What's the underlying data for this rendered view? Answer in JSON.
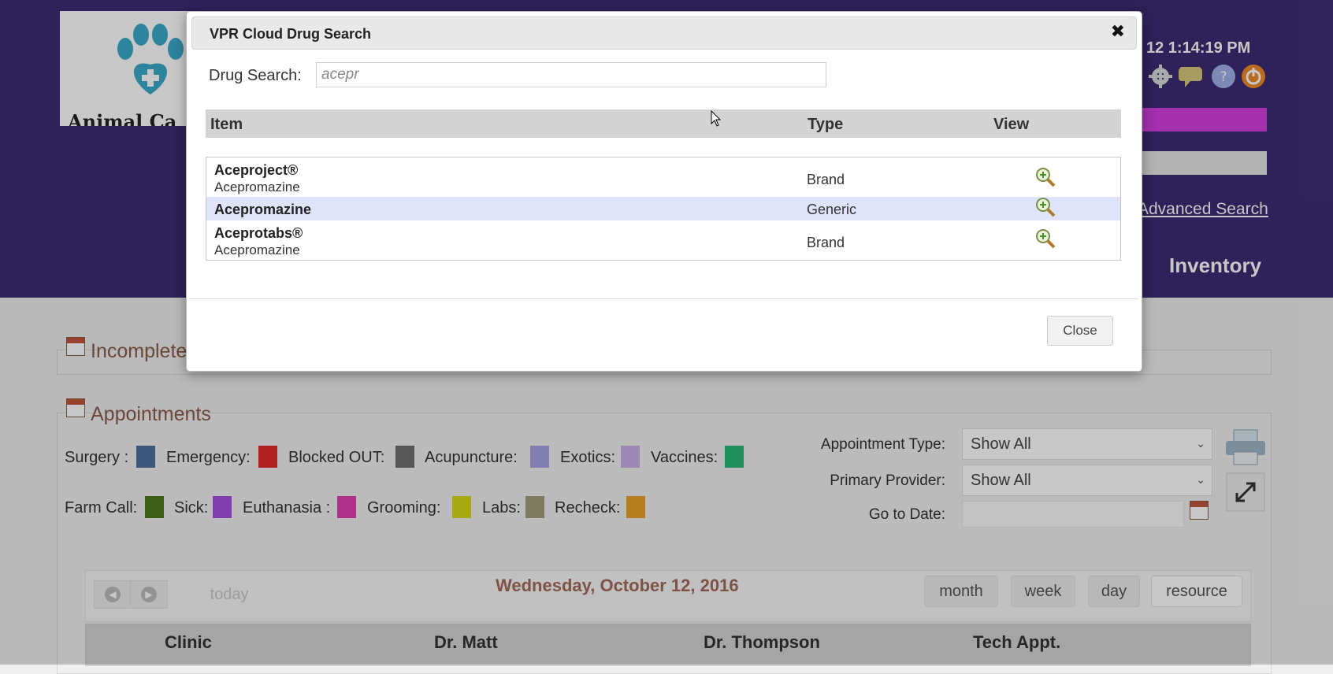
{
  "app": {
    "logo_text": "Animal Ca",
    "clock": "12 1:14:19 PM",
    "advanced_search": "Advanced Search",
    "inventory": "Inventory"
  },
  "incomplete": {
    "title": "Incomplete"
  },
  "appointments": {
    "title": "Appointments",
    "legend": [
      {
        "label": "Surgery :",
        "color": "#4f6f9e"
      },
      {
        "label": "Emergency:",
        "color": "#e02a2a"
      },
      {
        "label": "Blocked OUT:",
        "color": "#6f6f6f"
      },
      {
        "label": "Acupuncture:",
        "color": "#a6a3e6"
      },
      {
        "label": "Exotics:",
        "color": "#c8aee8"
      },
      {
        "label": "Vaccines:",
        "color": "#2bb873"
      },
      {
        "label": "Farm Call:",
        "color": "#4f7a1e"
      },
      {
        "label": "Sick:",
        "color": "#a54fe0"
      },
      {
        "label": "Euthanasia :",
        "color": "#e03fb0"
      },
      {
        "label": "Grooming:",
        "color": "#d8d81a"
      },
      {
        "label": "Labs:",
        "color": "#a39e7f"
      },
      {
        "label": "Recheck:",
        "color": "#e8a127"
      }
    ],
    "filters": {
      "appointment_type_label": "Appointment Type:",
      "appointment_type_value": "Show All",
      "primary_provider_label": "Primary Provider:",
      "primary_provider_value": "Show All",
      "go_to_date_label": "Go to Date:"
    },
    "calendar": {
      "today": "today",
      "date_title": "Wednesday, October 12, 2016",
      "views": [
        "month",
        "week",
        "day",
        "resource"
      ],
      "resources": [
        "Clinic",
        "Dr. Matt",
        "Dr. Thompson",
        "Tech Appt."
      ]
    }
  },
  "modal": {
    "title": "VPR Cloud Drug Search",
    "search_label": "Drug Search:",
    "search_value": "acepr",
    "columns": {
      "item": "Item",
      "type": "Type",
      "view": "View"
    },
    "rows": [
      {
        "name": "Aceproject®",
        "sub": "Acepromazine",
        "type": "Brand"
      },
      {
        "name": "Acepromazine",
        "sub": "",
        "type": "Generic",
        "selected": true
      },
      {
        "name": "Aceprotabs®",
        "sub": "Acepromazine",
        "type": "Brand"
      }
    ],
    "close_label": "Close"
  },
  "icons": {
    "close": "close-icon",
    "view": "magnifier-plus-icon",
    "gear": "gear-icon",
    "chat": "speech-bubble-icon",
    "help": "help-icon",
    "power": "power-icon",
    "print": "printer-icon",
    "expand": "expand-icon",
    "calendar": "calendar-icon"
  }
}
